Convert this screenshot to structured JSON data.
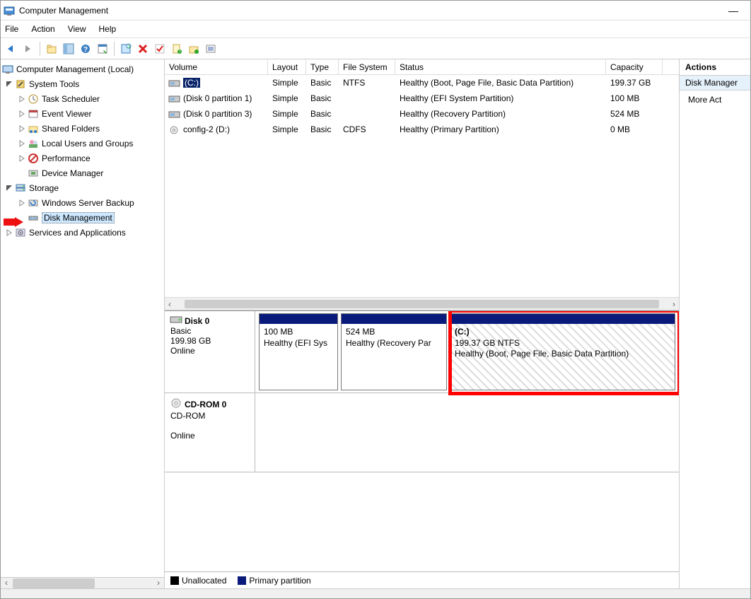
{
  "window": {
    "title": "Computer Management",
    "minimize": "—"
  },
  "menu": {
    "file": "File",
    "action": "Action",
    "view": "View",
    "help": "Help"
  },
  "tree": {
    "root": "Computer Management (Local)",
    "system_tools": "System Tools",
    "task_scheduler": "Task Scheduler",
    "event_viewer": "Event Viewer",
    "shared_folders": "Shared Folders",
    "local_users": "Local Users and Groups",
    "performance": "Performance",
    "device_manager": "Device Manager",
    "storage": "Storage",
    "wsb": "Windows Server Backup",
    "disk_mgmt": "Disk Management",
    "services": "Services and Applications"
  },
  "vol_headers": {
    "volume": "Volume",
    "layout": "Layout",
    "type": "Type",
    "fs": "File System",
    "status": "Status",
    "capacity": "Capacity"
  },
  "volumes": [
    {
      "name": "(C:)",
      "layout": "Simple",
      "type": "Basic",
      "fs": "NTFS",
      "status": "Healthy (Boot, Page File, Basic Data Partition)",
      "capacity": "199.37 GB",
      "selected": true,
      "icon": "drive"
    },
    {
      "name": "(Disk 0 partition 1)",
      "layout": "Simple",
      "type": "Basic",
      "fs": "",
      "status": "Healthy (EFI System Partition)",
      "capacity": "100 MB",
      "icon": "drive"
    },
    {
      "name": "(Disk 0 partition 3)",
      "layout": "Simple",
      "type": "Basic",
      "fs": "",
      "status": "Healthy (Recovery Partition)",
      "capacity": "524 MB",
      "icon": "drive"
    },
    {
      "name": "config-2 (D:)",
      "layout": "Simple",
      "type": "Basic",
      "fs": "CDFS",
      "status": "Healthy (Primary Partition)",
      "capacity": "0 MB",
      "icon": "cd"
    }
  ],
  "disks": {
    "d0": {
      "name": "Disk 0",
      "type": "Basic",
      "size": "199.98 GB",
      "state": "Online",
      "p1_l1": "100 MB",
      "p1_l2": "Healthy (EFI Sys",
      "p2_l1": "524 MB",
      "p2_l2": "Healthy (Recovery Par",
      "p3_l1": "(C:)",
      "p3_l2": "199.37 GB NTFS",
      "p3_l3": "Healthy (Boot, Page File, Basic Data Partition)"
    },
    "cd": {
      "name": "CD-ROM 0",
      "type": "CD-ROM",
      "state": "Online"
    }
  },
  "legend": {
    "unalloc": "Unallocated",
    "primary": "Primary partition"
  },
  "actions": {
    "header": "Actions",
    "category": "Disk Manager",
    "more": "More Act"
  }
}
